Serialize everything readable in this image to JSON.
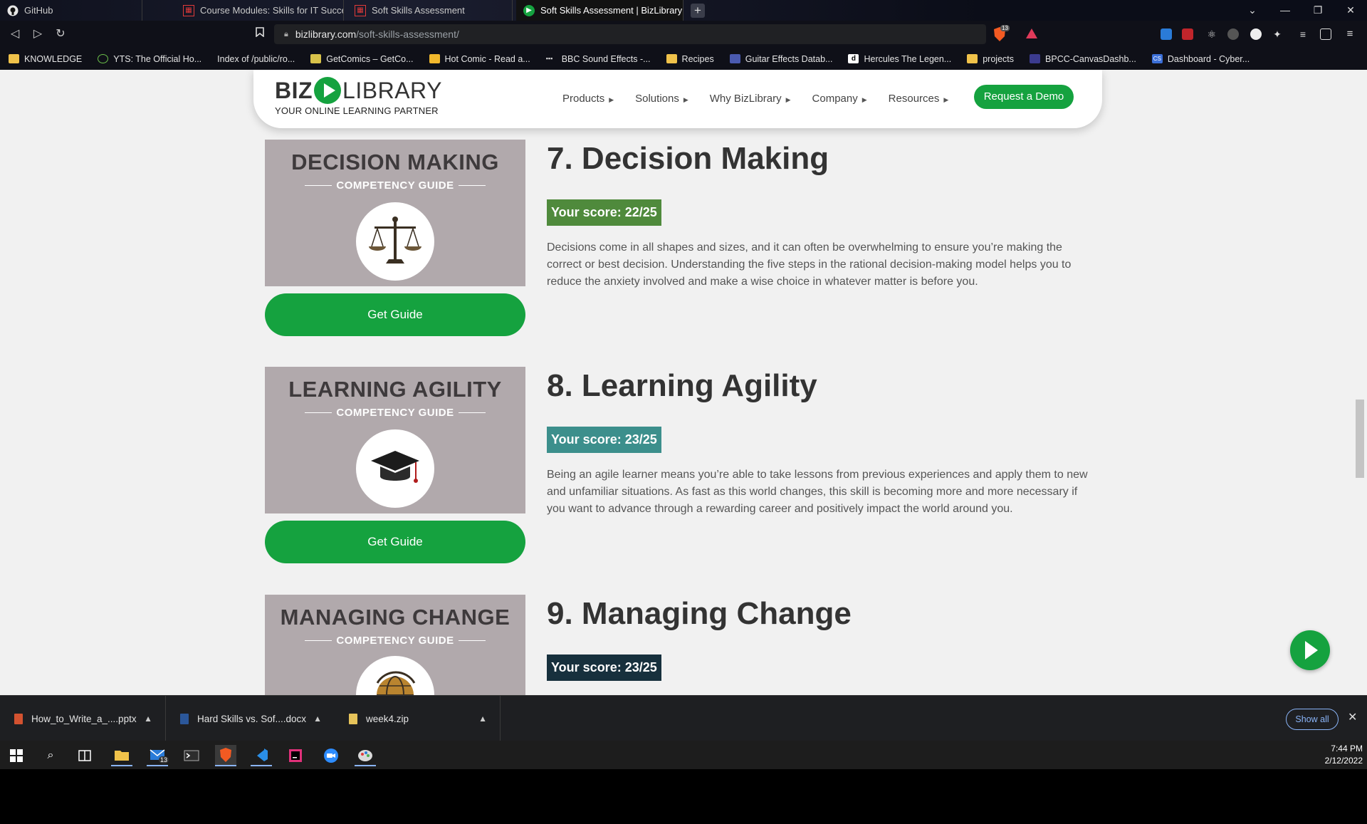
{
  "browser": {
    "tabs": [
      {
        "title": "GitHub",
        "favicon": "github-icon"
      },
      {
        "title": "Course Modules: Skills for IT Success",
        "favicon": "canvas-icon"
      },
      {
        "title": "Soft Skills Assessment",
        "favicon": "canvas-icon"
      },
      {
        "title": "Soft Skills Assessment | BizLibrary",
        "favicon": "bizlibrary-icon",
        "active": true
      }
    ],
    "new_tab_label": "+",
    "url_host": "bizlibrary.com",
    "url_path": "/soft-skills-assessment/",
    "shield_count": "13",
    "bookmarks": [
      {
        "label": "KNOWLEDGE",
        "icon": "folder-icon"
      },
      {
        "label": "YTS: The Official Ho...",
        "icon": "yts-icon"
      },
      {
        "label": "Index of /public/ro...",
        "icon": "none"
      },
      {
        "label": "GetComics – GetCo...",
        "icon": "getcomics-icon"
      },
      {
        "label": "Hot Comic - Read a...",
        "icon": "hotcomic-icon"
      },
      {
        "label": "BBC Sound Effects -...",
        "icon": "bbc-icon"
      },
      {
        "label": "Recipes",
        "icon": "folder-icon"
      },
      {
        "label": "Guitar Effects Datab...",
        "icon": "guitar-icon"
      },
      {
        "label": "Hercules The Legen...",
        "icon": "d-icon"
      },
      {
        "label": "projects",
        "icon": "folder-icon"
      },
      {
        "label": "BPCC-CanvasDashb...",
        "icon": "bpcc-icon"
      },
      {
        "label": "Dashboard - Cyber...",
        "icon": "cs-icon"
      }
    ]
  },
  "site": {
    "logo_left": "BIZ",
    "logo_right": "LIBRARY",
    "tagline": "YOUR ONLINE LEARNING PARTNER",
    "nav": [
      "Products",
      "Solutions",
      "Why BizLibrary",
      "Company",
      "Resources"
    ],
    "demo_button": "Request a Demo",
    "brand_color": "#15a23f"
  },
  "sections": [
    {
      "card_title": "DECISION MAKING",
      "card_subtitle": "COMPETENCY GUIDE",
      "icon": "scales-icon",
      "button": "Get Guide",
      "title": "7. Decision Making",
      "score": "Your score: 22/25",
      "score_color": "#4f8a3c",
      "description": "Decisions come in all shapes and sizes, and it can often be overwhelming to ensure you’re making the correct or best decision. Understanding the five steps in the rational decision-making model helps you to reduce the anxiety involved and make a wise choice in whatever matter is before you."
    },
    {
      "card_title": "LEARNING AGILITY",
      "card_subtitle": "COMPETENCY GUIDE",
      "icon": "graduation-cap-icon",
      "button": "Get Guide",
      "title": "8. Learning Agility",
      "score": "Your score: 23/25",
      "score_color": "#3c8f8c",
      "description": "Being an agile learner means you’re able to take lessons from previous experiences and apply them to new and unfamiliar situations. As fast as this world changes, this skill is becoming more and more necessary if you want to advance through a rewarding career and positively impact the world around you."
    },
    {
      "card_title": "MANAGING CHANGE",
      "card_subtitle": "COMPETENCY GUIDE",
      "icon": "globe-icon",
      "title": "9. Managing Change",
      "score": "Your score: 23/25",
      "score_color": "#17303d"
    }
  ],
  "downloads": {
    "items": [
      {
        "name": "How_to_Write_a_....pptx",
        "icon": "pptx-icon"
      },
      {
        "name": "Hard Skills vs. Sof....docx",
        "icon": "docx-icon"
      },
      {
        "name": "week4.zip",
        "icon": "zip-icon"
      }
    ],
    "show_all": "Show all"
  },
  "taskbar": {
    "mail_badge": "13",
    "time": "7:44 PM",
    "date": "2/12/2022"
  }
}
